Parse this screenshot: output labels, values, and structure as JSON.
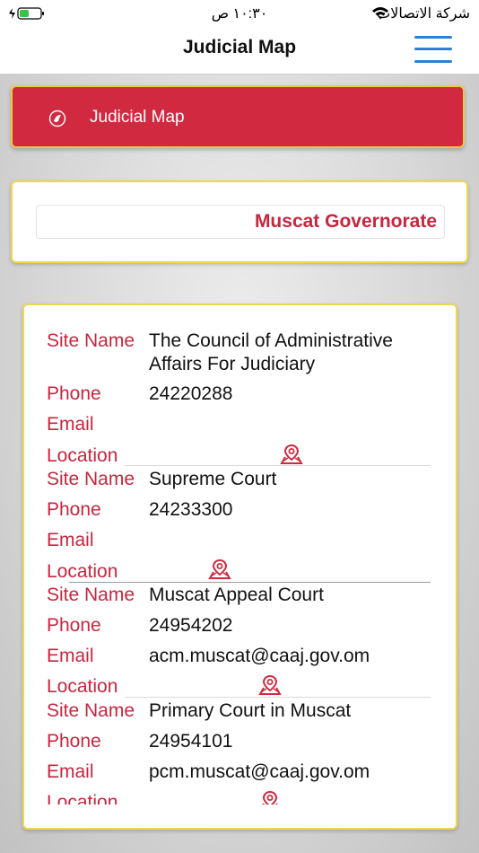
{
  "status_bar": {
    "time": "١٠:٣٠ ص",
    "carrier": "شركة الاتصالات"
  },
  "nav": {
    "title": "Judicial Map",
    "menu_icon": "hamburger-icon"
  },
  "banner": {
    "icon": "map-icon",
    "label": "Judicial Map"
  },
  "governorate": {
    "selected": "Muscat Governorate"
  },
  "labels": {
    "site_name": "Site Name",
    "phone": "Phone",
    "email": "Email",
    "location": "Location"
  },
  "sites": [
    {
      "name": "The Council of Administrative Affairs For Judiciary",
      "phone": "24220288",
      "email": "",
      "location_icon": "map-pin-icon"
    },
    {
      "name": "Supreme Court",
      "phone": "24233300",
      "email": "",
      "location_icon": "map-pin-icon"
    },
    {
      "name": "Muscat Appeal Court",
      "phone": "24954202",
      "email": "acm.muscat@caaj.gov.om",
      "location_icon": "map-pin-icon"
    },
    {
      "name": "Primary Court in Muscat",
      "phone": "24954101",
      "email": "pcm.muscat@caaj.gov.om",
      "location_icon": "map-pin-icon"
    }
  ],
  "colors": {
    "accent_red": "#c8253f",
    "banner_red": "#d12a40",
    "card_border": "#f0d74a",
    "menu_blue": "#2e7fd6"
  }
}
